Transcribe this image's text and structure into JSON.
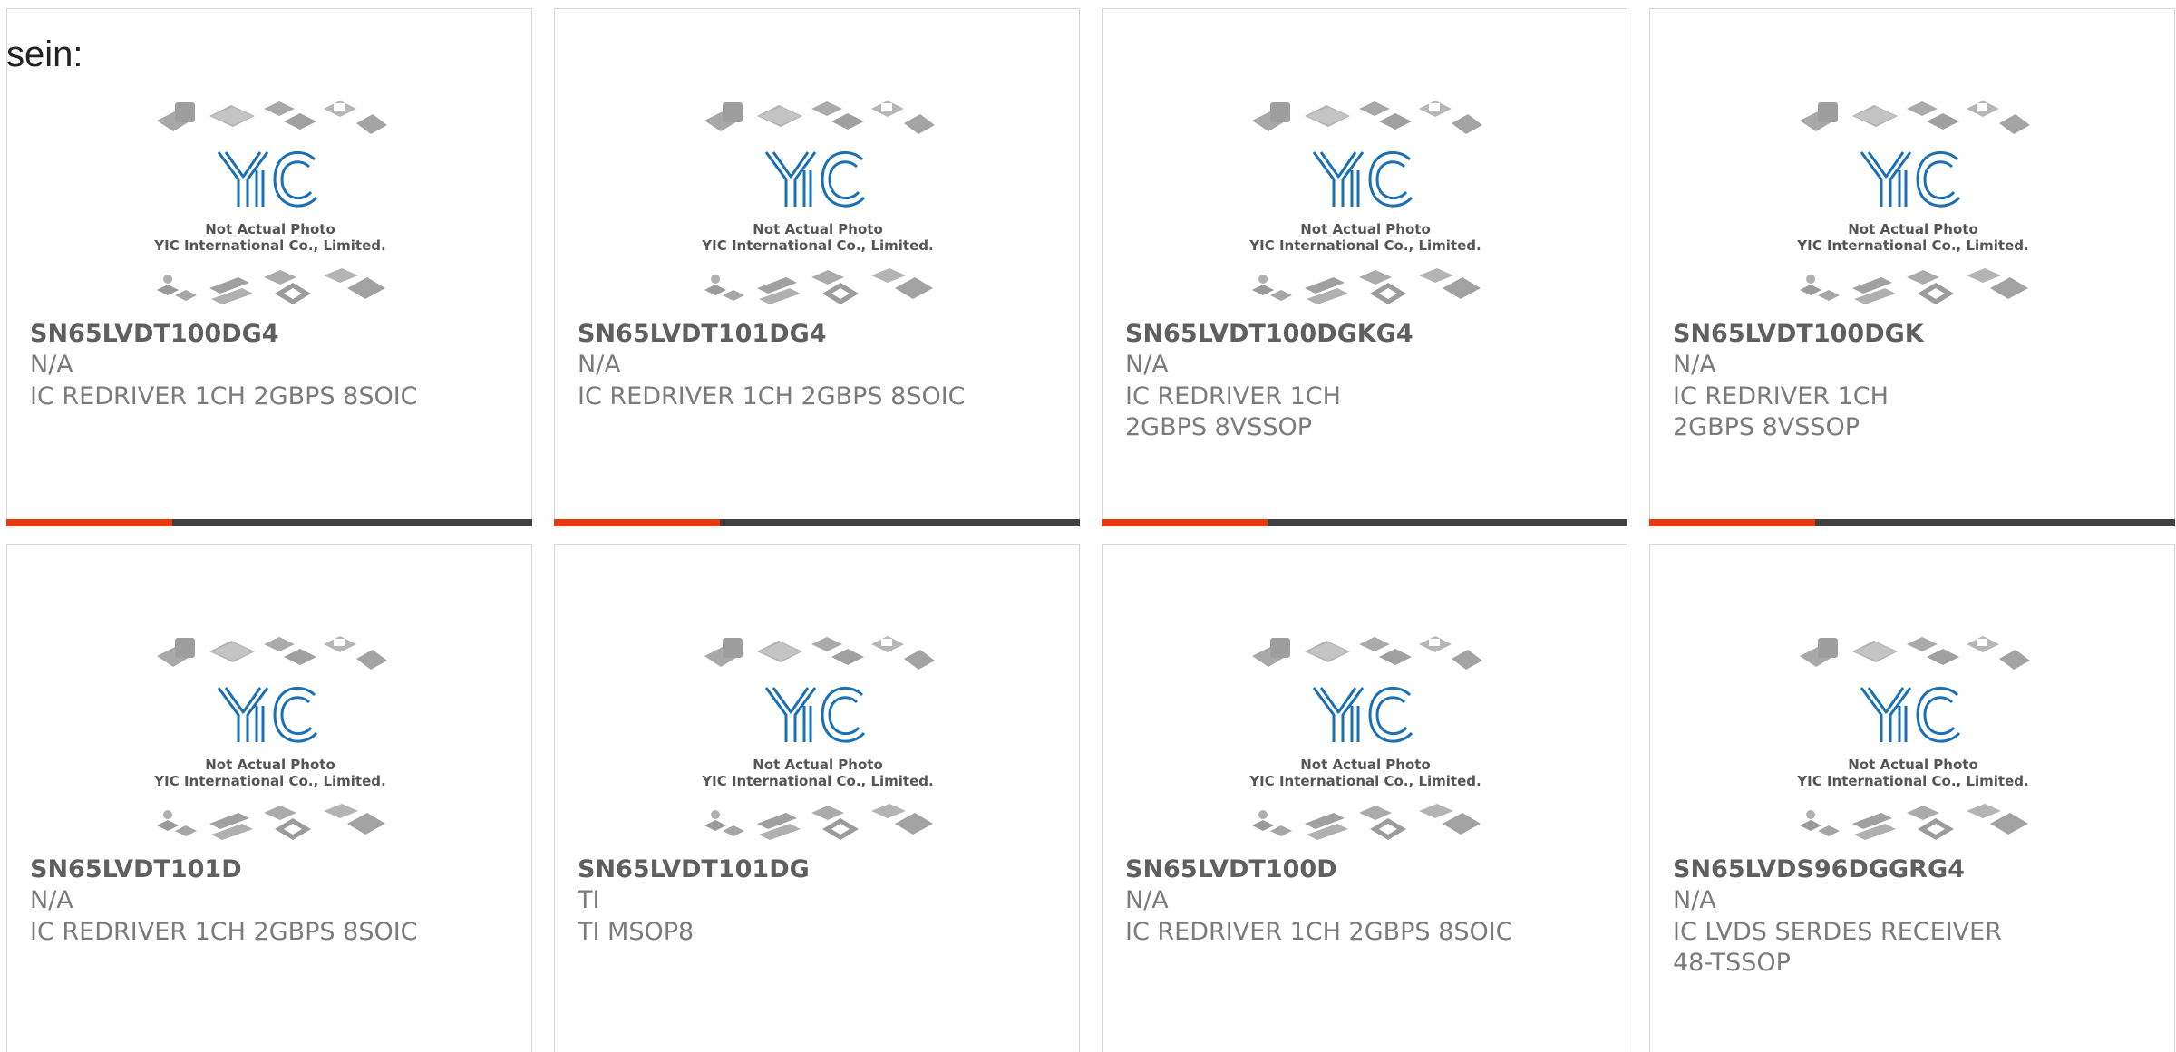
{
  "lead_text": "sein:",
  "photo": {
    "line1": "Not Actual Photo",
    "line2": "YIC International Co., Limited.",
    "logo_text": "YIC",
    "logo_color": "#1a6fb5"
  },
  "colors": {
    "accent": "#e8380d",
    "bar": "#404040"
  },
  "products": [
    {
      "part": "SN65LVDT100DG4",
      "manufacturer": "N/A",
      "description": "IC REDRIVER 1CH 2GBPS 8SOIC"
    },
    {
      "part": "SN65LVDT101DG4",
      "manufacturer": "N/A",
      "description": "IC REDRIVER 1CH 2GBPS 8SOIC"
    },
    {
      "part": "SN65LVDT100DGKG4",
      "manufacturer": "N/A",
      "description": "IC REDRIVER 1CH 2GBPS 8VSSOP"
    },
    {
      "part": "SN65LVDT100DGK",
      "manufacturer": "N/A",
      "description": "IC REDRIVER 1CH 2GBPS 8VSSOP"
    },
    {
      "part": "SN65LVDT101D",
      "manufacturer": "N/A",
      "description": "IC REDRIVER 1CH 2GBPS 8SOIC"
    },
    {
      "part": "SN65LVDT101DG",
      "manufacturer": "TI",
      "description": "TI MSOP8"
    },
    {
      "part": "SN65LVDT100D",
      "manufacturer": "N/A",
      "description": "IC REDRIVER 1CH 2GBPS 8SOIC"
    },
    {
      "part": "SN65LVDS96DGGRG4",
      "manufacturer": "N/A",
      "description": "IC LVDS SERDES RECEIVER 48-TSSOP"
    }
  ]
}
